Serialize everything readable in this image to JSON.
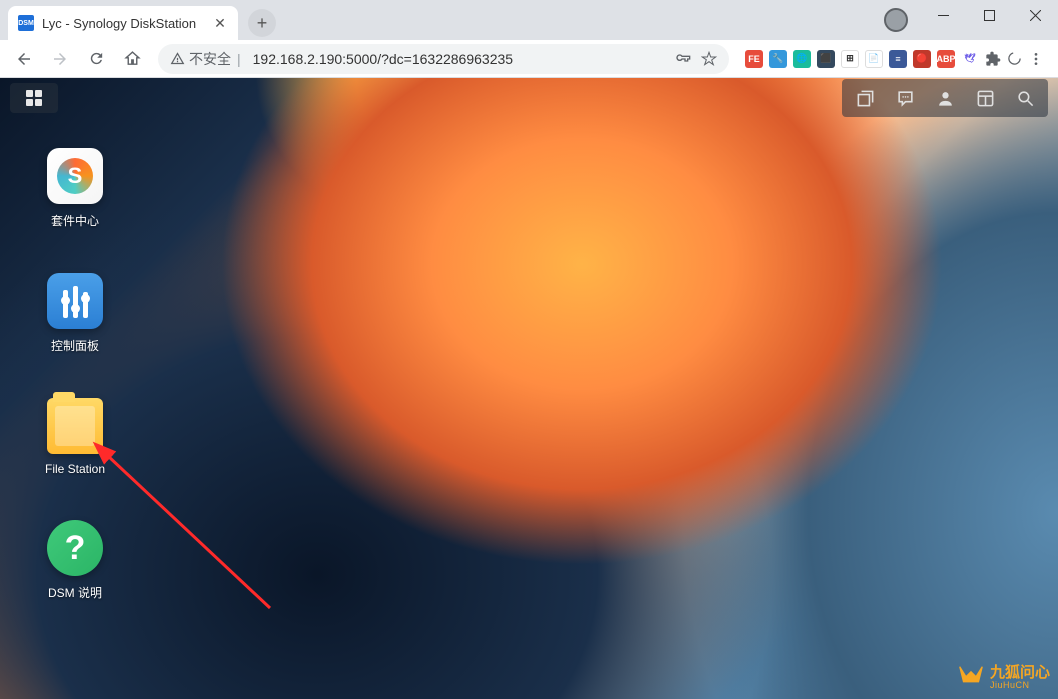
{
  "browser": {
    "tab_title": "Lyc - Synology DiskStation",
    "tab_favicon_text": "DSM",
    "security_label": "不安全",
    "url": "192.168.2.190:5000/?dc=1632286963235"
  },
  "dsm": {
    "desktop_icons": [
      {
        "id": "package-center",
        "label": "套件中心"
      },
      {
        "id": "control-panel",
        "label": "控制面板"
      },
      {
        "id": "file-station",
        "label": "File Station"
      },
      {
        "id": "dsm-help",
        "label": "DSM 说明"
      }
    ]
  },
  "watermark": {
    "cn": "九狐问心",
    "en": "JiuHuCN"
  }
}
